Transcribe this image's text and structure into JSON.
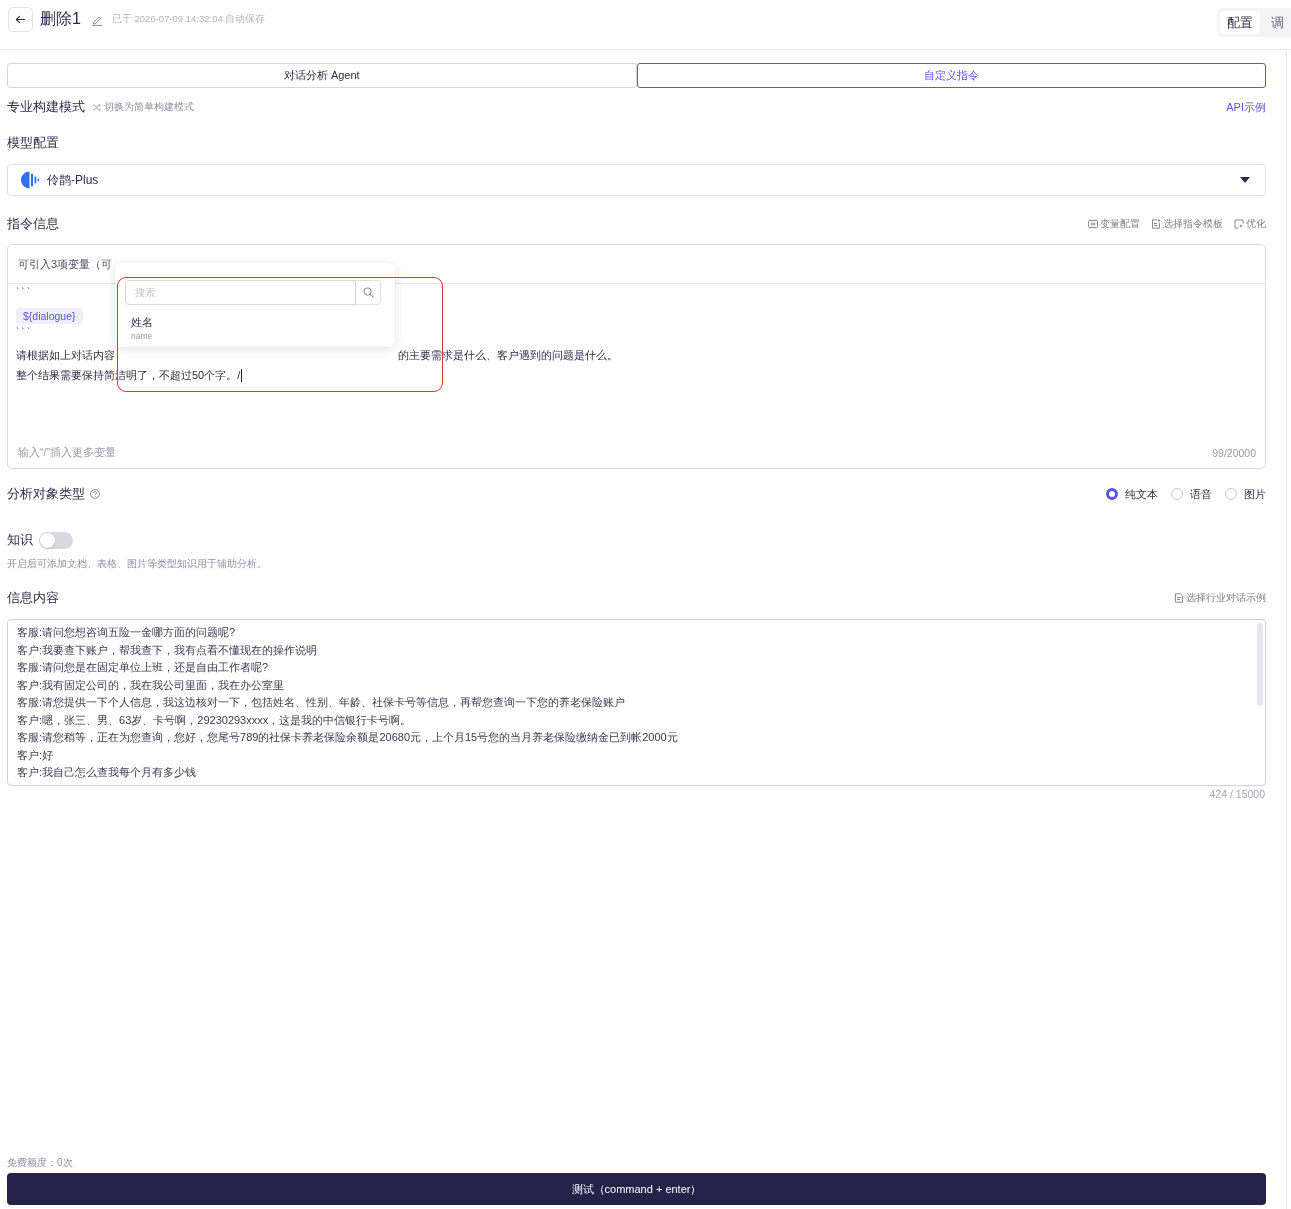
{
  "header": {
    "title": "删除1",
    "autosave": "已于 2026-07-09 14:32:04 自动保存",
    "view_tabs": [
      {
        "label": "配置",
        "selected": true
      },
      {
        "label": "调",
        "selected": false
      }
    ]
  },
  "mode_tabs": [
    {
      "label": "对话分析 Agent",
      "selected": false
    },
    {
      "label": "自定义指令",
      "selected": true
    }
  ],
  "build_mode": {
    "title": "专业构建模式",
    "switch_link": "切换为简单构建模式",
    "api_link": "API示例"
  },
  "model_config": {
    "title": "模型配置",
    "model": "伶鹊-Plus"
  },
  "instruction": {
    "title": "指令信息",
    "actions": [
      {
        "kind": "variables",
        "label": "变量配置"
      },
      {
        "kind": "template",
        "label": "选择指令模板"
      },
      {
        "kind": "optimize",
        "label": "优化"
      }
    ],
    "variables_hint": "可引入3项变量（可",
    "lines": [
      {
        "kind": "code",
        "text": "```"
      },
      {
        "kind": "variable",
        "text": "${dialogue}"
      },
      {
        "kind": "code",
        "text": "```"
      },
      {
        "kind": "covered",
        "left": "请根据如上对话内容",
        "right": "的主要需求是什么、客户遇到的问题是什么。"
      },
      {
        "kind": "text",
        "text": "整个结果需要保持简洁明了，不超过50个字。/",
        "cursor": true
      }
    ],
    "footer_hint": "输入“/”插入更多变量",
    "counter": "99/20000"
  },
  "variable_popup": {
    "search_placeholder": "搜索",
    "items": [
      {
        "label": "姓名",
        "key": "name"
      }
    ]
  },
  "analysis_type": {
    "title": "分析对象类型",
    "options": [
      {
        "label": "纯文本",
        "selected": true
      },
      {
        "label": "语音",
        "selected": false
      },
      {
        "label": "图片",
        "selected": false
      }
    ]
  },
  "knowledge": {
    "title": "知识",
    "on": false,
    "hint": "开启后可添加文档、表格、图片等类型知识用于辅助分析。"
  },
  "info_content": {
    "title": "信息内容",
    "example_link": "选择行业对话示例",
    "lines": [
      "客服:请问您想咨询五险一金哪方面的问题呢?",
      "客户:我要查下账户，帮我查下，我有点看不懂现在的操作说明",
      "客服:请问您是在固定单位上班，还是自由工作者呢?",
      "客户:我有固定公司的，我在我公司里面，我在办公室里",
      "客服:请您提供一下个人信息，我这边核对一下，包括姓名、性别、年龄、社保卡号等信息，再帮您查询一下您的养老保险账户",
      "客户:嗯，张三、男、63岁、卡号啊，29230293xxxx，这是我的中信银行卡号啊。",
      "客服:请您稍等，正在为您查询，您好，您尾号789的社保卡养老保险余额是20680元，上个月15号您的当月养老保险缴纳金已到帐2000元",
      "客户:好",
      "客户:我自己怎么查我每个月有多少钱"
    ],
    "counter": "424 / 15000"
  },
  "footer": {
    "quota": "免费额度：0次",
    "test_button": "测试（command + enter）"
  }
}
